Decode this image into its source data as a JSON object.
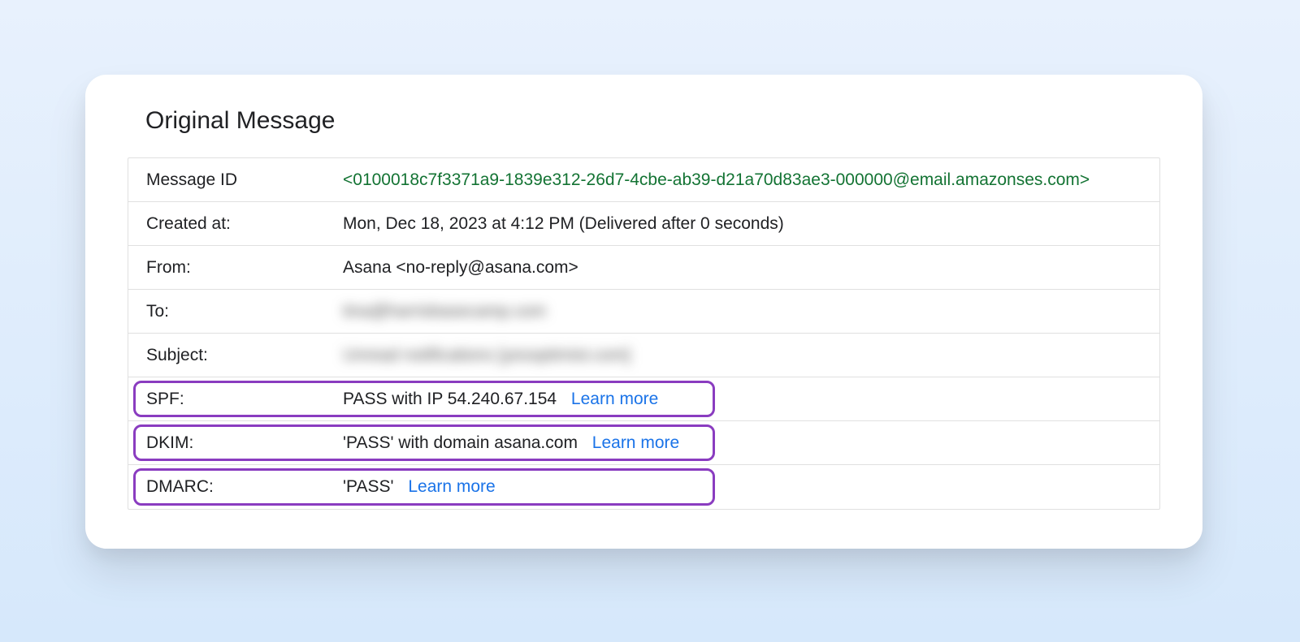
{
  "title": "Original Message",
  "rows": {
    "message_id": {
      "label": "Message ID",
      "value": "<0100018c7f3371a9-1839e312-26d7-4cbe-ab39-d21a70d83ae3-000000@email.amazonses.com>"
    },
    "created_at": {
      "label": "Created at:",
      "value": "Mon, Dec 18, 2023 at 4:12 PM (Delivered after 0 seconds)"
    },
    "from": {
      "label": "From:",
      "value": "Asana <no-reply@asana.com>"
    },
    "to": {
      "label": "To:",
      "value_blurred": "tina@harrisbasecamp.com"
    },
    "subject": {
      "label": "Subject:",
      "value_blurred": "Unread notifications [yesoptimist.com]"
    },
    "spf": {
      "label": "SPF:",
      "value": "PASS with IP 54.240.67.154",
      "learn_more": "Learn more"
    },
    "dkim": {
      "label": "DKIM:",
      "value": "'PASS' with domain asana.com",
      "learn_more": "Learn more"
    },
    "dmarc": {
      "label": "DMARC:",
      "value": "'PASS'",
      "learn_more": "Learn more"
    }
  },
  "highlight_widths": {
    "spf": 716,
    "dkim": 716,
    "dmarc": 716
  }
}
